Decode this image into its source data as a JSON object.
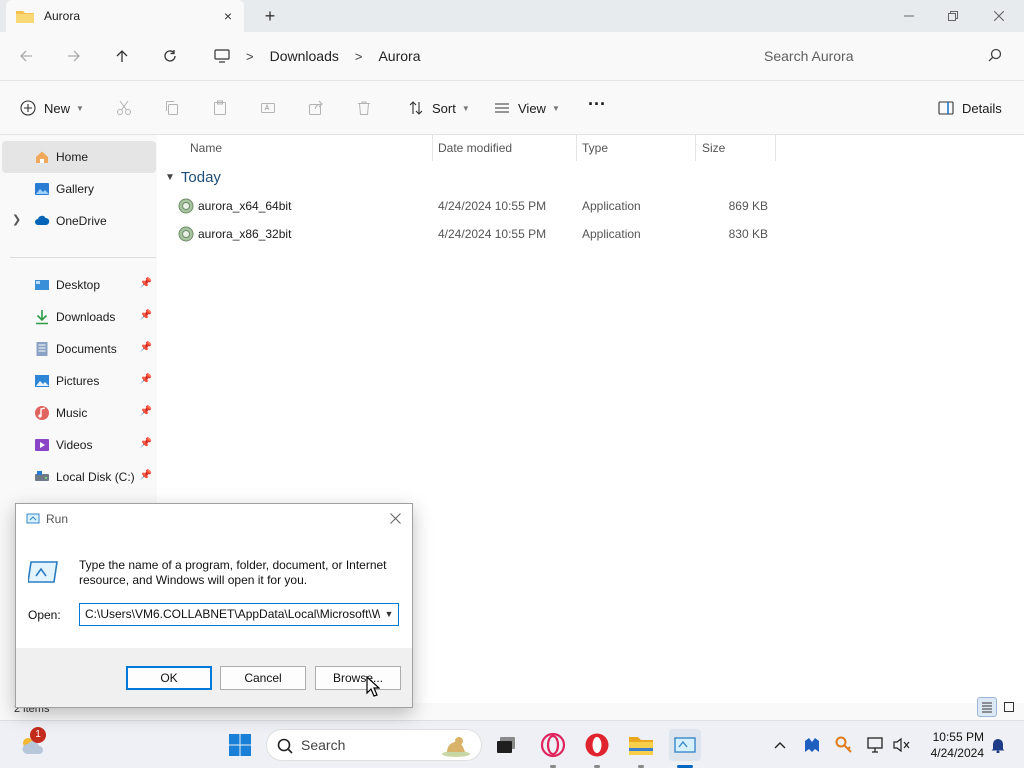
{
  "window": {
    "tab_title": "Aurora",
    "tab_close": "×",
    "tab_add": "+"
  },
  "address": {
    "crumbs": [
      "Downloads",
      "Aurora"
    ],
    "separator": ">"
  },
  "search": {
    "placeholder": "Search Aurora"
  },
  "toolbar": {
    "new_label": "New",
    "sort_label": "Sort",
    "view_label": "View",
    "more_label": "···",
    "details_label": "Details"
  },
  "sidebar": {
    "items": [
      {
        "label": "Home",
        "icon": "home-icon",
        "active": true
      },
      {
        "label": "Gallery",
        "icon": "gallery-icon"
      },
      {
        "label": "OneDrive",
        "icon": "cloud-icon"
      },
      {
        "label": "Desktop",
        "icon": "desktop-icon",
        "pinned": true
      },
      {
        "label": "Downloads",
        "icon": "download-icon",
        "pinned": true
      },
      {
        "label": "Documents",
        "icon": "document-icon",
        "pinned": true
      },
      {
        "label": "Pictures",
        "icon": "pictures-icon",
        "pinned": true
      },
      {
        "label": "Music",
        "icon": "music-icon",
        "pinned": true
      },
      {
        "label": "Videos",
        "icon": "videos-icon",
        "pinned": true
      },
      {
        "label": "Local Disk (C:)",
        "icon": "disk-icon",
        "pinned": true
      }
    ]
  },
  "filelist": {
    "columns": [
      "Name",
      "Date modified",
      "Type",
      "Size"
    ],
    "group": "Today",
    "rows": [
      {
        "name": "aurora_x64_64bit",
        "date": "4/24/2024 10:55 PM",
        "type": "Application",
        "size": "869 KB"
      },
      {
        "name": "aurora_x86_32bit",
        "date": "4/24/2024 10:55 PM",
        "type": "Application",
        "size": "830 KB"
      }
    ]
  },
  "status": {
    "items": "2 items"
  },
  "run_dialog": {
    "title": "Run",
    "description": "Type the name of a program, folder, document, or Internet resource, and Windows will open it for you.",
    "open_label": "Open:",
    "open_value": "C:\\Users\\VM6.COLLABNET\\AppData\\Local\\Microsoft\\W",
    "ok_label": "OK",
    "cancel_label": "Cancel",
    "browse_label": "Browse..."
  },
  "taskbar": {
    "search_label": "Search",
    "notification_badge": "1",
    "time": "10:55 PM",
    "date": "4/24/2024"
  },
  "colors": {
    "accent": "#0067c0",
    "folder": "#f2c14e",
    "group_text": "#1f4e79",
    "opera_red": "#e0242f"
  }
}
